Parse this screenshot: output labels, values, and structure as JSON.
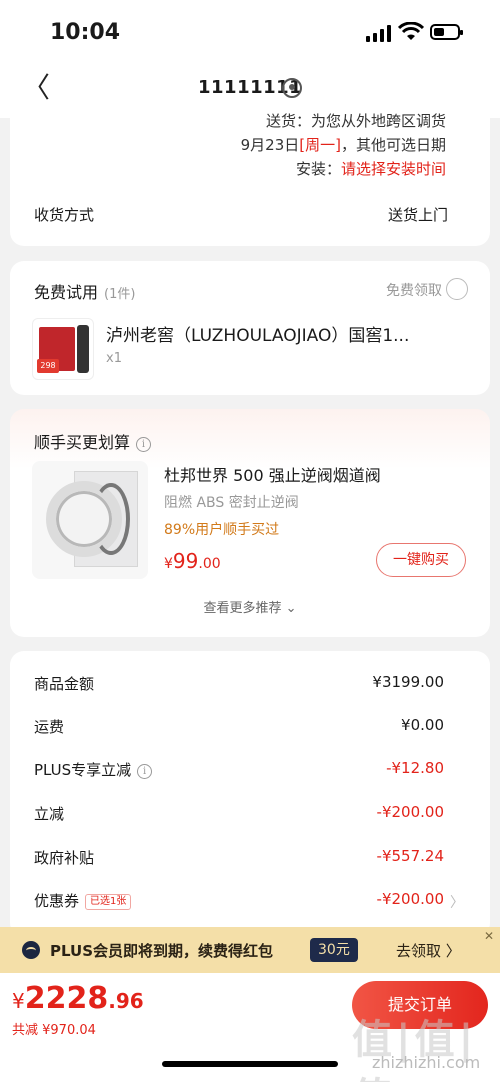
{
  "status": {
    "time": "10:04"
  },
  "nav": {
    "back": "〈",
    "title": "11111111"
  },
  "delivery": {
    "line1": "送货：为您从外地跨区调货",
    "date": "9月23日",
    "weekday": "[周一]",
    "other_dates": "，其他可选日期",
    "install_label": "安装：",
    "install_value": "请选择安装时间",
    "ship_method_label": "收货方式",
    "ship_method_value": "送货上门"
  },
  "trial": {
    "title": "免费试用",
    "count": "(1件)",
    "claim_label": "免费领取",
    "product_name": "泸州老窖（LUZHOULAOJIAO）国窖1...",
    "qty": "x1",
    "thumb_tag": "298"
  },
  "recommend": {
    "title": "顺手买更划算",
    "product_name": "杜邦世界 500 强止逆阀烟道阀",
    "subtitle": "阻燃 ABS 密封止逆阀",
    "bought": "89%用户顺手买过",
    "price_symbol": "¥",
    "price_int": "99",
    "price_dec": ".00",
    "buy_label": "一键购买",
    "more_label": "查看更多推荐 ⌄"
  },
  "summary": {
    "rows": [
      {
        "label": "商品金额",
        "value": "¥3199.00",
        "red": false
      },
      {
        "label": "运费",
        "value": "¥0.00",
        "red": false
      },
      {
        "label": "PLUS专享立减",
        "value": "-¥12.80",
        "red": true
      },
      {
        "label": "立减",
        "value": "-¥200.00",
        "red": true
      },
      {
        "label": "政府补贴",
        "value": "-¥557.24",
        "red": true
      },
      {
        "label": "优惠券",
        "value": "-¥200.00",
        "red": true
      }
    ],
    "coupon_badge": "已选1张"
  },
  "plus_banner": {
    "text": "PLUS会员即将到期，续费得红包",
    "amount": "30元",
    "action": "去领取 〉",
    "close": "✕"
  },
  "checkout": {
    "symbol": "¥",
    "total_int": "2228",
    "total_dec": ".96",
    "saved": "共减 ¥970.04",
    "submit_label": "提交订单"
  },
  "watermark": {
    "text": "值|值|值",
    "url": "zhizhizhi.com"
  },
  "colors": {
    "accent": "#e2231a",
    "plus_bg": "#f4dfa8",
    "page_bg": "#f2f2f2"
  }
}
